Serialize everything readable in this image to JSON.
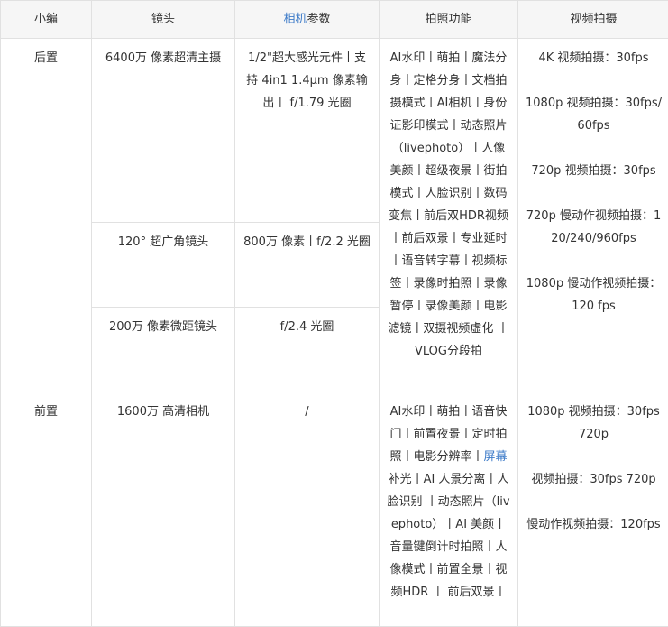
{
  "header": {
    "col0": "小编",
    "col1": "镜头",
    "col2_link": "相机",
    "col2_rest": "参数",
    "col3": "拍照功能",
    "col4": "视频拍摄"
  },
  "rear": {
    "label": "后置",
    "lens1": "6400万 像素超清主摄",
    "lens1_param": "1/2\"超大感光元件丨支持 4in1 1.4μm 像素输出丨 f/1.79 光圈",
    "lens2": "120° 超广角镜头",
    "lens2_param": "800万 像素丨f/2.2 光圈",
    "lens3": "200万 像素微距镜头",
    "lens3_param": "f/2.4 光圈",
    "features": "AI水印丨萌拍丨魔法分身丨定格分身丨文档拍摄模式丨AI相机丨身份证影印模式丨动态照片（livephoto）丨人像美颜丨超级夜景丨街拍模式丨人脸识别丨数码变焦丨前后双HDR视频丨前后双景丨专业延时丨语音转字幕丨视频标签丨录像时拍照丨录像暂停丨录像美颜丨电影滤镜丨双摄视频虚化 丨 VLOG分段拍",
    "video": [
      "4K 视频拍摄：30fps",
      "1080p 视频拍摄：30fps/60fps",
      "720p 视频拍摄：30fps",
      "720p 慢动作视频拍摄：120/240/960fps",
      "1080p 慢动作视频拍摄：120 fps"
    ]
  },
  "front": {
    "label": "前置",
    "lens": "1600万 高清相机",
    "param": "/",
    "features_a": "AI水印丨萌拍丨语音快门丨前置夜景丨定时拍照丨电影分辨率丨",
    "features_link": "屏幕",
    "features_b": "补光丨AI 人景分离丨人脸识别 丨动态照片（livephoto）丨AI 美颜丨音量键倒计时拍照丨人像模式丨前置全景丨视频HDR 丨 前后双景丨",
    "video": [
      "1080p 视频拍摄：30fps720p",
      "视频拍摄：30fps 720p",
      "慢动作视频拍摄：120fps"
    ]
  }
}
